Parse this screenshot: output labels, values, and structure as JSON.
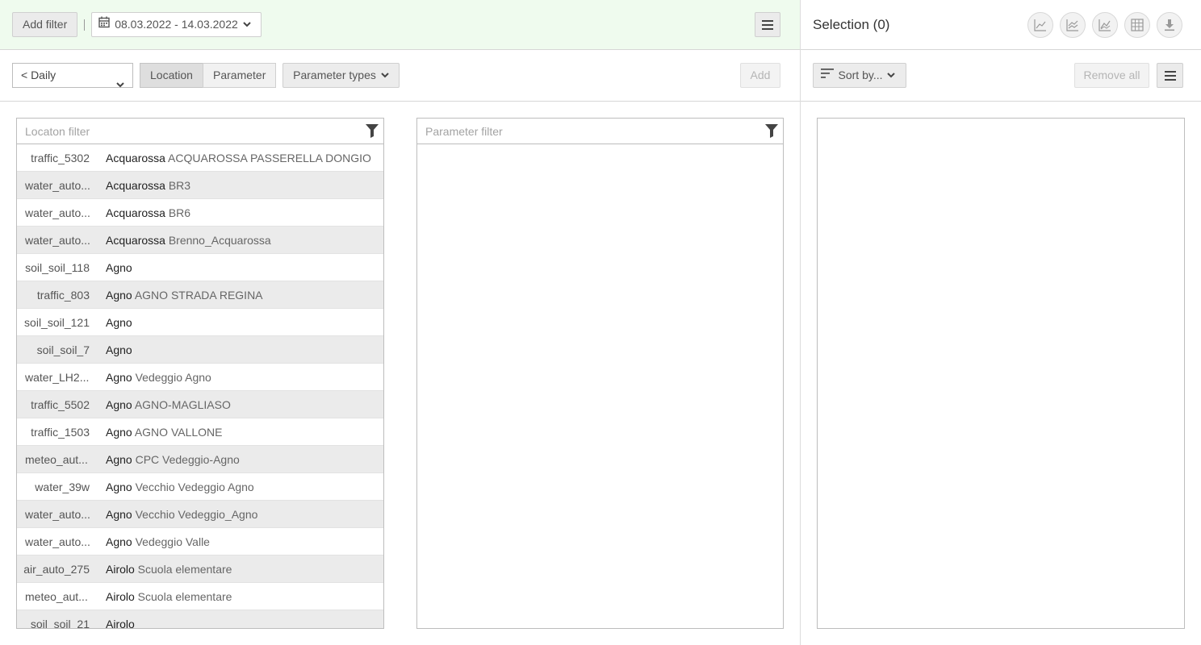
{
  "topbar": {
    "add_filter": "Add filter",
    "date_range": "08.03.2022 - 14.03.2022"
  },
  "toolbar": {
    "interval": "< Daily",
    "tabs": [
      "Location",
      "Parameter"
    ],
    "active_tab": "Location",
    "parameter_types": "Parameter types",
    "add": "Add"
  },
  "location_panel": {
    "filter_placeholder": "Locaton filter",
    "rows": [
      {
        "id": "traffic_5302",
        "name_bold": "Acquarossa",
        "name_rest": " ACQUAROSSA PASSERELLA DONGIO"
      },
      {
        "id": "water_auto...",
        "name_bold": "Acquarossa",
        "name_rest": " BR3"
      },
      {
        "id": "water_auto...",
        "name_bold": "Acquarossa",
        "name_rest": " BR6"
      },
      {
        "id": "water_auto...",
        "name_bold": "Acquarossa",
        "name_rest": " Brenno_Acquarossa"
      },
      {
        "id": "soil_soil_118",
        "name_bold": "Agno",
        "name_rest": ""
      },
      {
        "id": "traffic_803",
        "name_bold": "Agno",
        "name_rest": " AGNO STRADA REGINA"
      },
      {
        "id": "soil_soil_121",
        "name_bold": "Agno",
        "name_rest": ""
      },
      {
        "id": "soil_soil_7",
        "name_bold": "Agno",
        "name_rest": ""
      },
      {
        "id": "water_LH2...",
        "name_bold": "Agno",
        "name_rest": " Vedeggio Agno"
      },
      {
        "id": "traffic_5502",
        "name_bold": "Agno",
        "name_rest": " AGNO-MAGLIASO"
      },
      {
        "id": "traffic_1503",
        "name_bold": "Agno",
        "name_rest": " AGNO VALLONE"
      },
      {
        "id": "meteo_aut...",
        "name_bold": "Agno",
        "name_rest": " CPC Vedeggio-Agno"
      },
      {
        "id": "water_39w",
        "name_bold": "Agno",
        "name_rest": " Vecchio Vedeggio Agno"
      },
      {
        "id": "water_auto...",
        "name_bold": "Agno",
        "name_rest": " Vecchio Vedeggio_Agno"
      },
      {
        "id": "water_auto...",
        "name_bold": "Agno",
        "name_rest": " Vedeggio Valle"
      },
      {
        "id": "air_auto_275",
        "name_bold": "Airolo",
        "name_rest": " Scuola elementare"
      },
      {
        "id": "meteo_aut...",
        "name_bold": "Airolo",
        "name_rest": " Scuola elementare"
      },
      {
        "id": "soil_soil_21",
        "name_bold": "Airolo",
        "name_rest": ""
      }
    ]
  },
  "parameter_panel": {
    "filter_placeholder": "Parameter filter"
  },
  "selection": {
    "title": "Selection (0)",
    "icons": [
      "line-chart-icon",
      "multi-line-chart-icon",
      "area-chart-icon",
      "table-icon",
      "download-icon"
    ],
    "sort_label": "Sort by...",
    "remove_all": "Remove all"
  },
  "colors": {
    "topbar_bg": "#effbee",
    "row_alt": "#ebebeb"
  }
}
